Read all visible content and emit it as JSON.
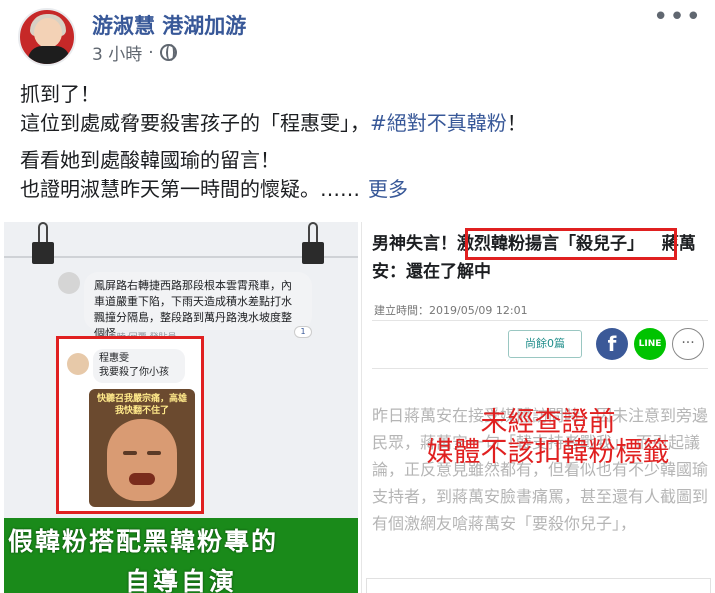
{
  "post": {
    "author": "游淑慧 港湖加游",
    "time": "3 小時",
    "separator": "·",
    "more_icon": "•••",
    "line1": "抓到了！",
    "line2_prefix": "這位到處威脅要殺害孩子的「程惠雯」，",
    "hashtag": "#絕對不真韓粉",
    "line2_suffix": "！",
    "line3": "看看她到處酸韓國瑜的留言！",
    "line4": "也證明淑慧昨天第一時間的懷疑。……",
    "see_more": "更多"
  },
  "left_photo": {
    "comment_top": "鳳屏路右轉捷西路那段根本雲霄飛車，內車道嚴重下陷，下雨天造成積水差點打水飄撞分隔島，整段路到萬丹路洩水坡度整個怪......",
    "comment_actions": "7小時   回覆   發貼員",
    "reaction": "1",
    "commenter": "程惠雯",
    "comment_text": "我要殺了你小孩",
    "meme_caption": "快聽召我嚴宗痛，高雄我快翻不住了",
    "banner_line1": "假韓粉搭配黑韓粉專的",
    "banner_line2": "自導自演"
  },
  "right_photo": {
    "title_part1": "男神失言！",
    "title_highlight": "激烈韓粉揚言「殺兒子」",
    "title_part2": "蔣萬安：還在了解中",
    "date": "建立時間：2019/05/09 12:01",
    "share_count": "尚餘0篇",
    "fb_icon": "f",
    "line_icon": "LINE",
    "more_share": "···",
    "body": "昨日蔣萬安在接受媒體訪問時，因未注意到旁邊民眾，蔣萬安一句「韓支持者戰我」，而引起議論，正反意見雖然都有，但看似也有不少韓國瑜支持者，到蔣萬安臉書痛罵，甚至還有人截圖到有個激網友嗆蔣萬安「要殺你兒子」，",
    "overlay_line1": "未經查證前",
    "overlay_line2": "媒體不該扣韓粉標籤"
  },
  "colors": {
    "link_blue": "#385898",
    "highlight_red": "#e02020",
    "banner_green": "#1a8a1a"
  }
}
